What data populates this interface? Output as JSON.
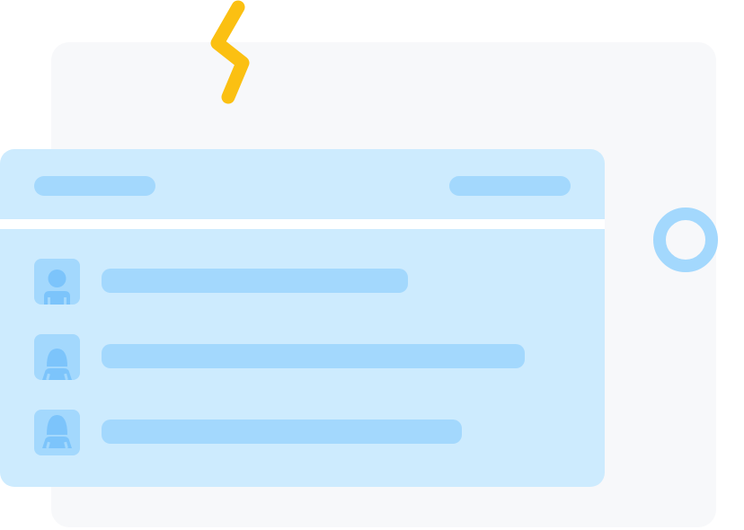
{
  "illustration": {
    "colors": {
      "background_card": "#f7f8fa",
      "panel": "#cdebfe",
      "placeholder": "#a3d8fd",
      "avatar_figure": "#7cc4fb",
      "bolt": "#fbc012",
      "ring": "#a3d8fd"
    },
    "icons": {
      "decoration_bolt": "lightning-bolt-icon",
      "decoration_ring": "ring-icon"
    },
    "list": {
      "rows": [
        {
          "avatar": "user-male-icon"
        },
        {
          "avatar": "user-female-icon"
        },
        {
          "avatar": "user-female-icon"
        }
      ]
    }
  }
}
